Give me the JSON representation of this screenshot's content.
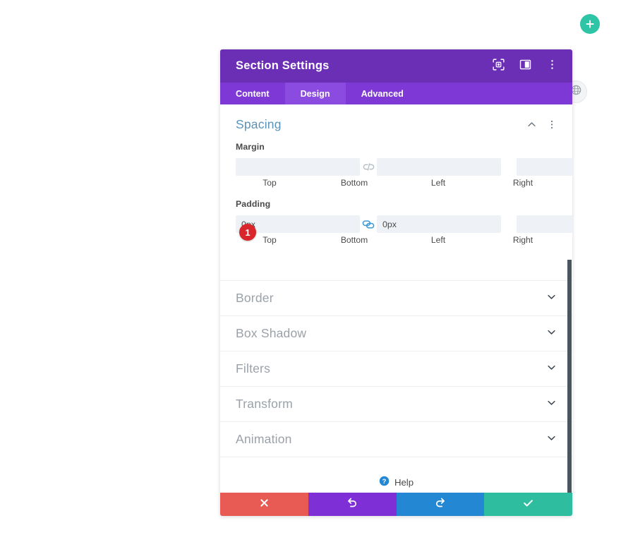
{
  "fab": {
    "name": "add-section-button",
    "icon": "plus-icon",
    "color": "#2ec4a6"
  },
  "globe_chip": {
    "icon": "globe-icon"
  },
  "modal": {
    "title": "Section Settings",
    "header_icons": [
      {
        "id": "focus-icon",
        "title": "Focus"
      },
      {
        "id": "panel-layout-icon",
        "title": "Layout"
      },
      {
        "id": "more-vertical-icon",
        "title": "More"
      }
    ],
    "tabs": [
      {
        "label": "Content",
        "active": false
      },
      {
        "label": "Design",
        "active": true
      },
      {
        "label": "Advanced",
        "active": false
      }
    ],
    "colors": {
      "header_bg": "#6b2fb5",
      "tabbar_bg": "#7e38d6",
      "tab_active_bg": "#8b4ae0",
      "section_title": "#5b93b8",
      "collapsed_title": "#9aa1a9",
      "input_bg": "#eef1f5",
      "link_active": "#3c9bd6",
      "link_inactive": "#b4bcc4",
      "badge": "#d8262c",
      "cancel": "#e85a54",
      "undo": "#7e2fd6",
      "redo": "#2487d4",
      "save": "#2ebd9e",
      "scrollbar": "#4a5560"
    },
    "spacing": {
      "title": "Spacing",
      "collapse_icon": "chevron-up-icon",
      "menu_icon": "more-vertical-icon",
      "margin": {
        "label": "Margin",
        "fields": [
          {
            "label": "Top",
            "value": "",
            "placeholder": ""
          },
          {
            "label": "Bottom",
            "value": "",
            "placeholder": ""
          },
          {
            "label": "Left",
            "value": "",
            "placeholder": ""
          },
          {
            "label": "Right",
            "value": "",
            "placeholder": ""
          }
        ],
        "link_left": {
          "icon": "link-broken-icon",
          "state": "unlinked"
        },
        "link_right": {
          "icon": "link-broken-icon",
          "state": "unlinked"
        }
      },
      "padding": {
        "label": "Padding",
        "marker": "1",
        "fields": [
          {
            "label": "Top",
            "value": "0px",
            "placeholder": ""
          },
          {
            "label": "Bottom",
            "value": "0px",
            "placeholder": ""
          },
          {
            "label": "Left",
            "value": "",
            "placeholder": ""
          },
          {
            "label": "Right",
            "value": "",
            "placeholder": ""
          }
        ],
        "link_left": {
          "icon": "link-connected-icon",
          "state": "linked"
        },
        "link_right": {
          "icon": "link-broken-icon",
          "state": "unlinked"
        }
      }
    },
    "collapsed_sections": [
      {
        "title": "Border",
        "icon": "chevron-down-icon"
      },
      {
        "title": "Box Shadow",
        "icon": "chevron-down-icon"
      },
      {
        "title": "Filters",
        "icon": "chevron-down-icon"
      },
      {
        "title": "Transform",
        "icon": "chevron-down-icon"
      },
      {
        "title": "Animation",
        "icon": "chevron-down-icon"
      }
    ],
    "help": {
      "label": "Help",
      "icon": "help-circle-icon"
    },
    "footer": [
      {
        "id": "cancel-button",
        "icon": "close-x-icon",
        "class": "cancel"
      },
      {
        "id": "undo-button",
        "icon": "undo-icon",
        "class": "undo"
      },
      {
        "id": "redo-button",
        "icon": "redo-icon",
        "class": "redo"
      },
      {
        "id": "save-button",
        "icon": "checkmark-icon",
        "class": "save"
      }
    ]
  }
}
